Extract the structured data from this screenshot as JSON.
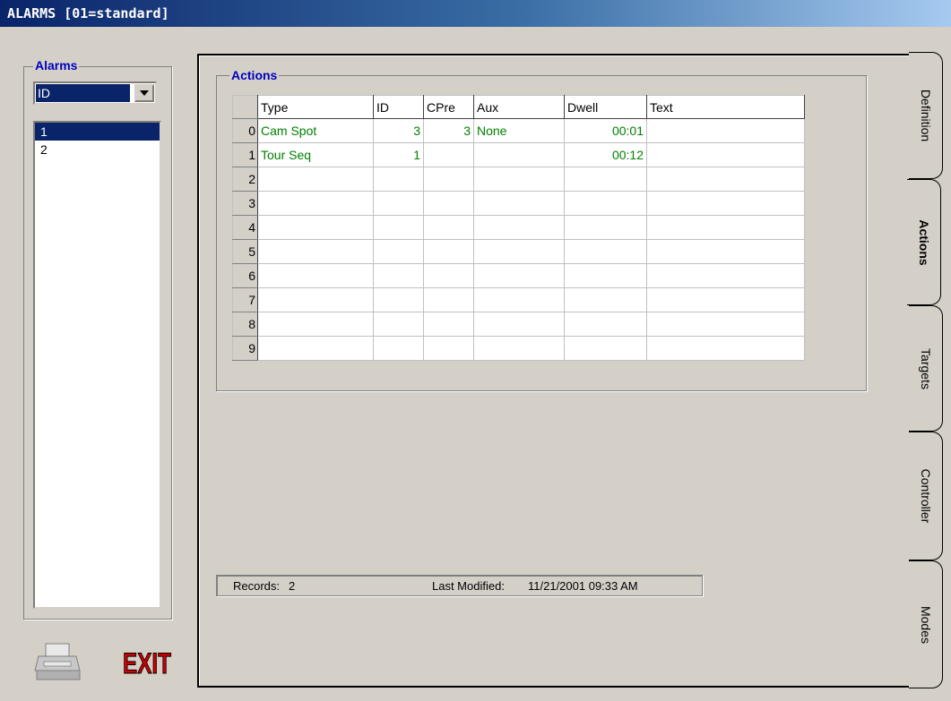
{
  "window": {
    "title": "ALARMS [01=standard]"
  },
  "alarms": {
    "group_label": "Alarms",
    "sort_value": "ID",
    "items": [
      "1",
      "2"
    ]
  },
  "buttons": {
    "print_icon": "printer-icon",
    "exit_label": "EXIT"
  },
  "actions": {
    "group_label": "Actions",
    "columns": [
      "Type",
      "ID",
      "CPre",
      "Aux",
      "Dwell",
      "Text"
    ],
    "rows": [
      {
        "n": "0",
        "type": "Cam Spot",
        "id": "3",
        "cpre": "3",
        "aux": "None",
        "dwell": "00:01",
        "text": ""
      },
      {
        "n": "1",
        "type": "Tour Seq",
        "id": "1",
        "cpre": "",
        "aux": "",
        "dwell": "00:12",
        "text": ""
      },
      {
        "n": "2",
        "type": "",
        "id": "",
        "cpre": "",
        "aux": "",
        "dwell": "",
        "text": ""
      },
      {
        "n": "3",
        "type": "",
        "id": "",
        "cpre": "",
        "aux": "",
        "dwell": "",
        "text": ""
      },
      {
        "n": "4",
        "type": "",
        "id": "",
        "cpre": "",
        "aux": "",
        "dwell": "",
        "text": ""
      },
      {
        "n": "5",
        "type": "",
        "id": "",
        "cpre": "",
        "aux": "",
        "dwell": "",
        "text": ""
      },
      {
        "n": "6",
        "type": "",
        "id": "",
        "cpre": "",
        "aux": "",
        "dwell": "",
        "text": ""
      },
      {
        "n": "7",
        "type": "",
        "id": "",
        "cpre": "",
        "aux": "",
        "dwell": "",
        "text": ""
      },
      {
        "n": "8",
        "type": "",
        "id": "",
        "cpre": "",
        "aux": "",
        "dwell": "",
        "text": ""
      },
      {
        "n": "9",
        "type": "",
        "id": "",
        "cpre": "",
        "aux": "",
        "dwell": "",
        "text": ""
      }
    ]
  },
  "status": {
    "records_label": "Records:",
    "records_value": "2",
    "modified_label": "Last Modified:",
    "modified_value": "11/21/2001 09:33 AM"
  },
  "tabs": [
    {
      "label": "Definition",
      "active": false
    },
    {
      "label": "Actions",
      "active": true
    },
    {
      "label": "Targets",
      "active": false
    },
    {
      "label": "Controller",
      "active": false
    },
    {
      "label": "Modes",
      "active": false
    }
  ],
  "colors": {
    "accent": "#0a246a",
    "group_label": "#0000c0",
    "grid_text": "#008000",
    "exit": "#cc0000"
  }
}
